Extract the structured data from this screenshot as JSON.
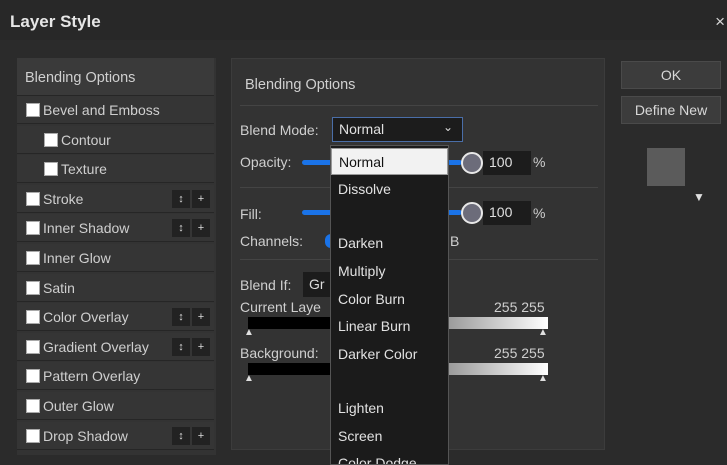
{
  "window": {
    "title": "Layer Style",
    "close_glyph": "×"
  },
  "effects_panel": {
    "header": "Blending Options",
    "items": [
      {
        "label": "Bevel and Emboss",
        "indent": false,
        "has_add": false
      },
      {
        "label": "Contour",
        "indent": true,
        "has_add": false
      },
      {
        "label": "Texture",
        "indent": true,
        "has_add": false
      },
      {
        "label": "Stroke",
        "indent": false,
        "has_add": true
      },
      {
        "label": "Inner Shadow",
        "indent": false,
        "has_add": true
      },
      {
        "label": "Inner Glow",
        "indent": false,
        "has_add": false
      },
      {
        "label": "Satin",
        "indent": false,
        "has_add": false
      },
      {
        "label": "Color Overlay",
        "indent": false,
        "has_add": true
      },
      {
        "label": "Gradient Overlay",
        "indent": false,
        "has_add": true
      },
      {
        "label": "Pattern Overlay",
        "indent": false,
        "has_add": false
      },
      {
        "label": "Outer Glow",
        "indent": false,
        "has_add": false
      },
      {
        "label": "Drop Shadow",
        "indent": false,
        "has_add": true
      }
    ],
    "reorder_glyph": "↕",
    "add_glyph": "+"
  },
  "blending": {
    "title": "Blending Options",
    "blend_mode_label": "Blend Mode:",
    "blend_mode_value": "Normal",
    "opacity_label": "Opacity:",
    "opacity_value": "100",
    "fill_label": "Fill:",
    "fill_value": "100",
    "percent": "%",
    "channels_label": "Channels:",
    "channels_tail": "B",
    "blend_if_label": "Blend If:",
    "blend_if_value": "Gr",
    "current_layer_label": "Current Laye",
    "current_layer_values": "255 255",
    "background_label": "Background:",
    "background_values": "255 255"
  },
  "blend_mode_options": [
    "Normal",
    "Dissolve",
    "",
    "Darken",
    "Multiply",
    "Color Burn",
    "Linear Burn",
    "Darker Color",
    "",
    "Lighten",
    "Screen",
    "Color Dodge"
  ],
  "buttons": {
    "ok": "OK",
    "define_new": "Define New"
  },
  "colors": {
    "accent": "#1a73e8",
    "background": "#2b2b2b",
    "panel": "#333333"
  }
}
